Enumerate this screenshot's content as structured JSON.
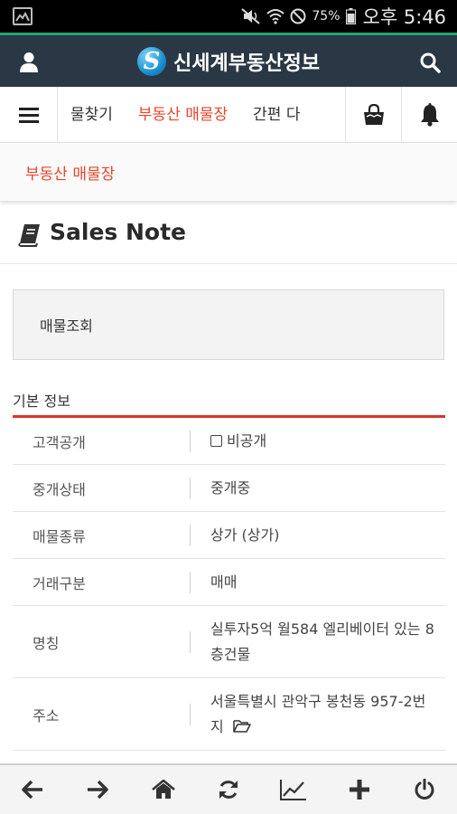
{
  "status_bar": {
    "battery_percent": "75%",
    "time": "오후 5:46"
  },
  "header": {
    "brand_name": "신세계부동산정보",
    "accent_color": "#25a36e",
    "bg_color": "#2a3845"
  },
  "nav": {
    "tabs": [
      {
        "label": "물찾기"
      },
      {
        "label": "부동산 매물장"
      },
      {
        "label": "간편 다"
      }
    ],
    "active_color": "#e8452c"
  },
  "sub_title": "부동산 매물장",
  "page_heading": "Sales Note",
  "search_box": {
    "label": "매물조회"
  },
  "section": {
    "title": "기본 정보"
  },
  "rows": [
    {
      "label": "고객공개",
      "value": "비공개",
      "checkbox": true
    },
    {
      "label": "중개상태",
      "value": "중개중"
    },
    {
      "label": "매물종류",
      "value": "상가 (상가)"
    },
    {
      "label": "거래구분",
      "value": "매매"
    },
    {
      "label": "명칭",
      "value": "실투자5억 월584 엘리베이터 있는 8층건물"
    },
    {
      "label": "주소",
      "value": "서울특별시 관악구 봉천동 957-2번지"
    }
  ],
  "icons": {
    "status_left": "gallery-icon",
    "user": "user-icon",
    "search": "search-icon",
    "menu": "hamburger-menu-icon",
    "bag": "shopping-bag-icon",
    "bell": "bell-icon",
    "book": "book-icon",
    "folder": "folder-open-icon",
    "bottom": [
      "arrow-left-icon",
      "arrow-right-icon",
      "home-icon",
      "refresh-icon",
      "chart-icon",
      "plus-icon",
      "power-icon"
    ]
  }
}
